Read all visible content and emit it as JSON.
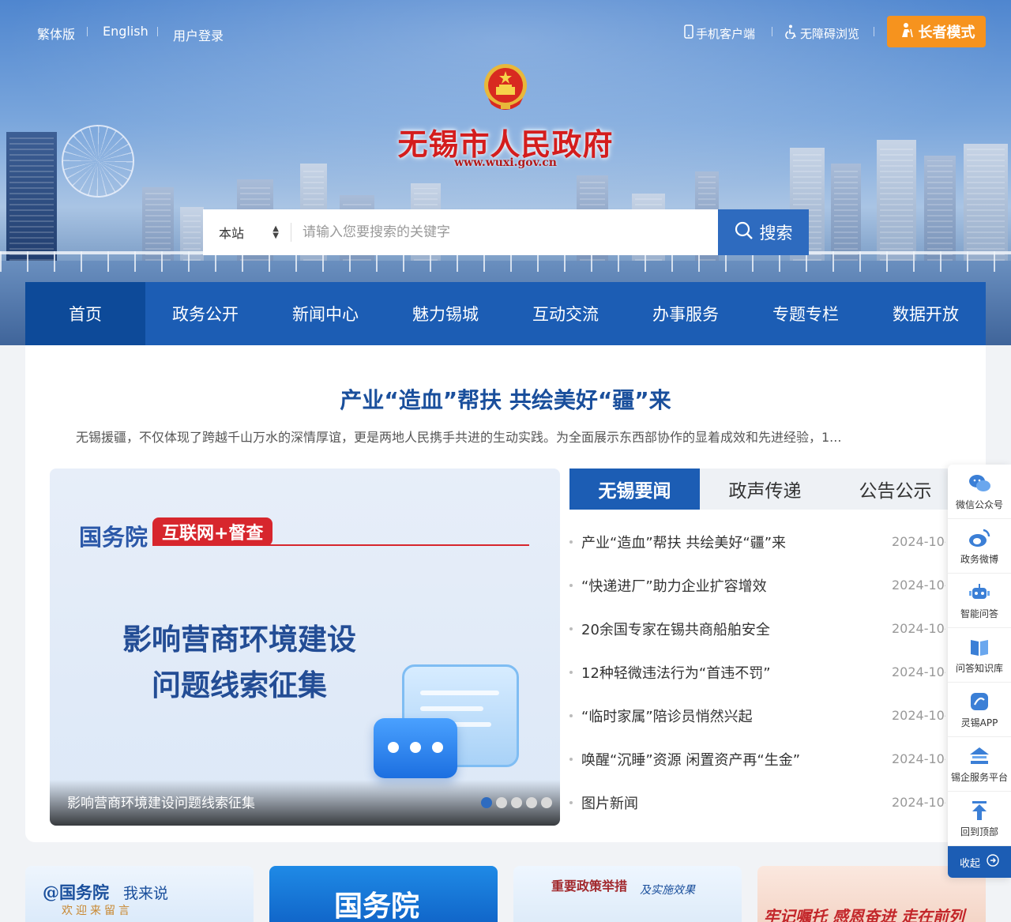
{
  "top_links": {
    "traditional": "繁体版",
    "english": "English",
    "login": "用户登录",
    "mobile": "手机客户端",
    "accessibility": "无障碍浏览",
    "elder_mode": "长者模式"
  },
  "site": {
    "title": "无锡市人民政府",
    "url": "www.wuxi.gov.cn"
  },
  "search": {
    "scope": "本站",
    "placeholder": "请输入您要搜索的关键字",
    "button": "搜索"
  },
  "nav": [
    "首页",
    "政务公开",
    "新闻中心",
    "魅力锡城",
    "互动交流",
    "办事服务",
    "专题专栏",
    "数据开放"
  ],
  "headline": {
    "title": "产业“造血”帮扶 共绘美好“疆”来",
    "summary": "无锡援疆，不仅体现了跨越千山万水的深情厚谊，更是两地人民携手共进的生动实践。为全面展示东西部协作的显着成效和先进经验，1..."
  },
  "slide": {
    "org": "国务院",
    "tag": "互联网+督查",
    "line1": "影响营商环境建设",
    "line2": "问题线索征集",
    "caption": "影响营商环境建设问题线索征集",
    "dots": 5,
    "active_dot": 0
  },
  "tabs": [
    "无锡要闻",
    "政声传递",
    "公告公示"
  ],
  "news": [
    {
      "title": "产业“造血”帮扶 共绘美好“疆”来",
      "date": "2024-10-"
    },
    {
      "title": "“快递进厂”助力企业扩容增效",
      "date": "2024-10-"
    },
    {
      "title": "20余国专家在锡共商船舶安全",
      "date": "2024-10-"
    },
    {
      "title": "12种轻微违法行为“首违不罚”",
      "date": "2024-10-"
    },
    {
      "title": "“临时家属”陪诊员悄然兴起",
      "date": "2024-10-"
    },
    {
      "title": "唤醒“沉睡”资源 闲置资产再“生金”",
      "date": "2024-10-"
    },
    {
      "title": "图片新闻",
      "date": "2024-10-"
    }
  ],
  "cards": {
    "card1_title": "@国务院",
    "card1_sub": "我来说",
    "card1_note": "欢迎来留言",
    "card2_title": "国务院",
    "card3_title": "重要政策举措",
    "card3_sub": "及实施效果",
    "card4_title": "牢记嘱托 感恩奋进 走在前列"
  },
  "float_bar": {
    "items": [
      "微信公众号",
      "政务微博",
      "智能问答",
      "问答知识库",
      "灵锡APP",
      "锡企服务平台",
      "回到顶部"
    ],
    "collapse": "收起"
  },
  "colors": {
    "primary": "#1c5db4",
    "active_nav": "#0d4a99",
    "elder_button": "#f6931e",
    "title_red": "#d41d1d"
  }
}
